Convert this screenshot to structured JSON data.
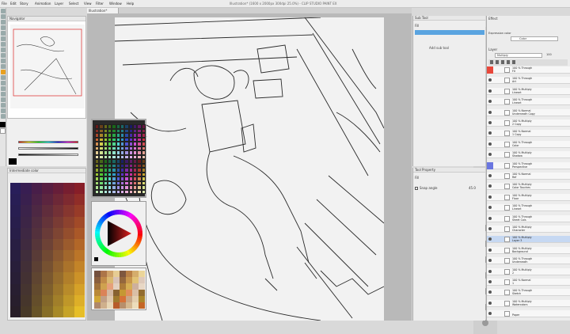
{
  "menu": [
    "File",
    "Edit",
    "Story",
    "Animation",
    "Layer",
    "Select",
    "View",
    "Filter",
    "Window",
    "Help"
  ],
  "window_title": "Illustration* (1600 x 2000px 300dpi 25.0%) - CLIP STUDIO PAINT EX",
  "tab_label": "Illustration*",
  "navigator_title": "Navigator",
  "palette_title": "Intermediate color",
  "subtool_title": "Sub Tool",
  "subtool_item": "Fill",
  "add_subtool": "Add sub tool",
  "tool_property_title": "Tool Property",
  "tool_property_item": "Fill",
  "snap_label": "Snap angle",
  "snap_value": "45.0",
  "effect_label": "Effect",
  "expression_label": "Expression color",
  "expression_value": "Color",
  "layer_panel_title": "Layer",
  "layer_blend": "Multiply",
  "layer_opacity": "100",
  "layers": [
    {
      "a": "100 % Through",
      "b": "FX",
      "flag": "#e8473a"
    },
    {
      "a": "100 % Through",
      "b": "Art",
      "flag": ""
    },
    {
      "a": "100 % Multiply",
      "b": "Lineart",
      "flag": ""
    },
    {
      "a": "100 % Through",
      "b": "Lineart",
      "flag": ""
    },
    {
      "a": "100 % Normal",
      "b": "Underneath Copy",
      "flag": ""
    },
    {
      "a": "100 % Multiply",
      "b": "2 Copy",
      "flag": ""
    },
    {
      "a": "100 % Normal",
      "b": "1 Copy",
      "flag": ""
    },
    {
      "a": "100 % Through",
      "b": "Color",
      "flag": ""
    },
    {
      "a": "100 % Multiply",
      "b": "Shadow",
      "flag": ""
    },
    {
      "a": "100 % Through",
      "b": "Perspective",
      "flag": "#6a76e0"
    },
    {
      "a": "100 % Normal",
      "b": "Ref",
      "flag": ""
    },
    {
      "a": "100 % Multiply",
      "b": "Color Touches",
      "flag": ""
    },
    {
      "a": "100 % Multiply",
      "b": "Floor",
      "flag": ""
    },
    {
      "a": "100 % Through",
      "b": "Lineart",
      "flag": ""
    },
    {
      "a": "100 % Through",
      "b": "Sheet Cols",
      "flag": ""
    },
    {
      "a": "100 % Multiply",
      "b": "Character",
      "flag": ""
    },
    {
      "a": "100 % Multiply",
      "b": "Layer 3",
      "flag": ""
    },
    {
      "a": "100 % Multiply",
      "b": "Background",
      "flag": ""
    },
    {
      "a": "100 % Through",
      "b": "Underneath",
      "flag": ""
    },
    {
      "a": "100 % Multiply",
      "b": "2",
      "flag": ""
    },
    {
      "a": "100 % Normal",
      "b": "1",
      "flag": ""
    },
    {
      "a": "100 % Through",
      "b": "Sketch",
      "flag": ""
    },
    {
      "a": "100 % Multiply",
      "b": "Watercolors",
      "flag": ""
    },
    {
      "a": "",
      "b": "Paper",
      "flag": ""
    }
  ],
  "colors": {
    "accent": "#e8a020",
    "selection": "#c6d8f2",
    "hue_ring": "rainbow"
  }
}
